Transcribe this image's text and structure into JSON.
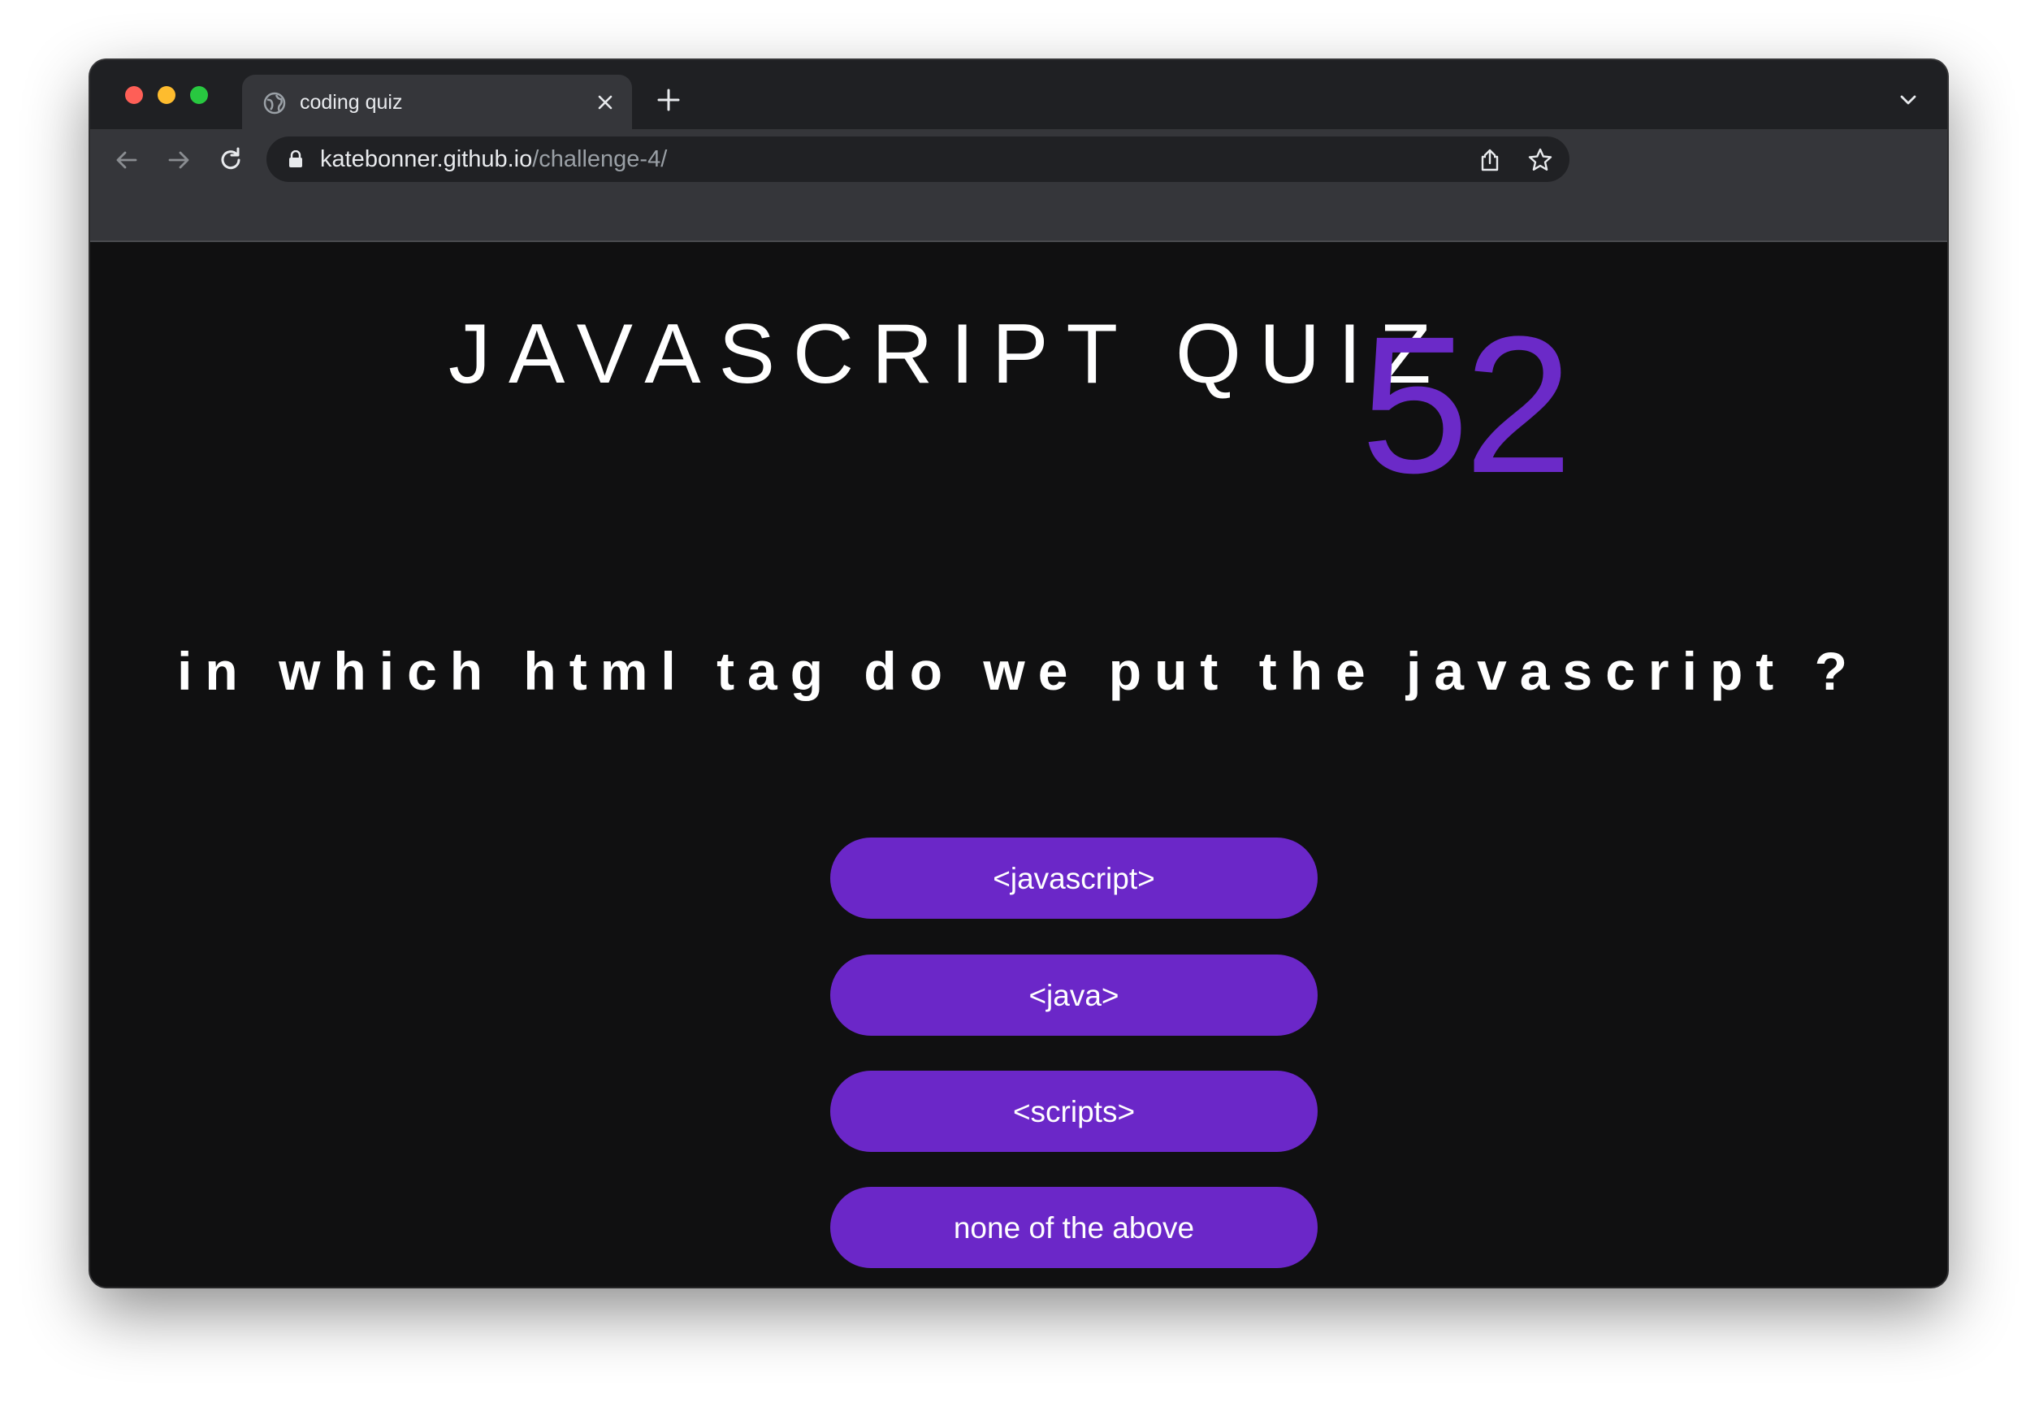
{
  "browser": {
    "tab": {
      "title": "coding quiz",
      "favicon": "globe-icon"
    },
    "address_bar": {
      "host": "katebonner.github.io",
      "path": "/challenge-4/"
    }
  },
  "quiz": {
    "title": "JAVASCRIPT QUIZ",
    "timer": "52",
    "question": "in which html tag do we put the javascript ?",
    "answers": [
      "<javascript>",
      "<java>",
      "<scripts>",
      "none of the above"
    ]
  },
  "colors": {
    "accent": "#6b27c8",
    "page_background": "#101011",
    "text": "#ffffff"
  }
}
